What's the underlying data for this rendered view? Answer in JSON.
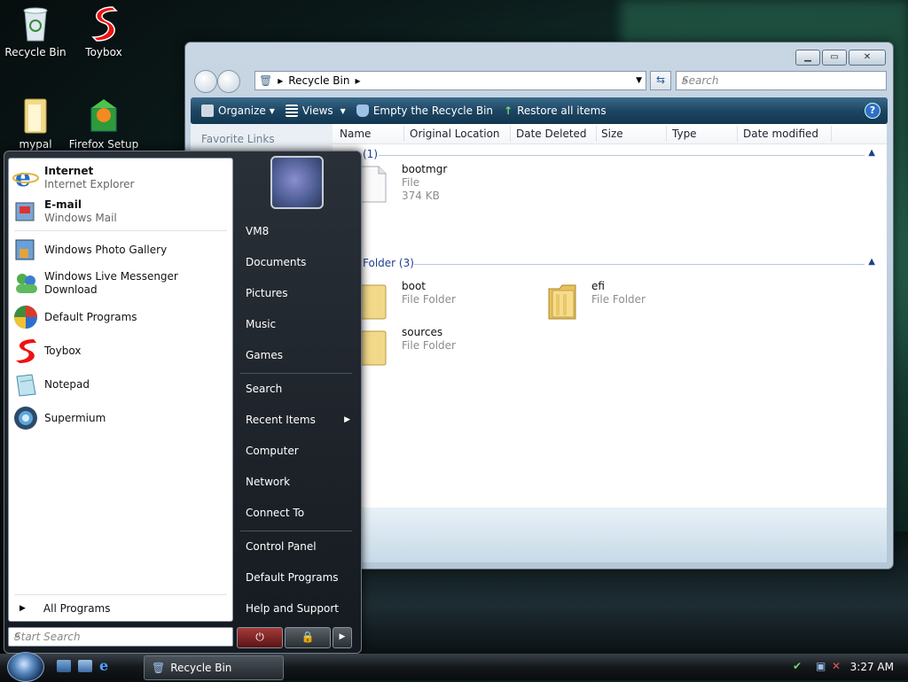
{
  "desktop": {
    "icons": [
      {
        "label": "Recycle Bin"
      },
      {
        "label": "Toybox"
      },
      {
        "label": "mypal"
      },
      {
        "label": "Firefox Setup"
      }
    ]
  },
  "explorer": {
    "address": {
      "segment": "Recycle Bin"
    },
    "search": {
      "placeholder": "Search"
    },
    "toolbar": {
      "organize": "Organize",
      "views": "Views",
      "empty": "Empty the Recycle Bin",
      "restore": "Restore all items"
    },
    "pane": {
      "title": "Favorite Links"
    },
    "columns": [
      "Name",
      "Original Location",
      "Date Deleted",
      "Size",
      "Type",
      "Date modified"
    ],
    "group1": {
      "label": "(1)"
    },
    "group2": {
      "label": "Folder (3)"
    },
    "files": [
      {
        "name": "bootmgr",
        "type": "File",
        "size": "374 KB"
      },
      {
        "name": "boot",
        "type": "File Folder"
      },
      {
        "name": "efi",
        "type": "File Folder"
      },
      {
        "name": "sources",
        "type": "File Folder"
      }
    ]
  },
  "start_menu": {
    "pinned": [
      {
        "title": "Internet",
        "sub": "Internet Explorer"
      },
      {
        "title": "E-mail",
        "sub": "Windows Mail"
      }
    ],
    "recent": [
      {
        "title": "Windows Photo Gallery"
      },
      {
        "title": "Windows Live Messenger Download"
      },
      {
        "title": "Default Programs"
      },
      {
        "title": "Toybox"
      },
      {
        "title": "Notepad"
      },
      {
        "title": "Supermium"
      }
    ],
    "all_programs": "All Programs",
    "search_placeholder": "Start Search",
    "right": [
      "VM8",
      "Documents",
      "Pictures",
      "Music",
      "Games",
      "Search",
      "Recent Items",
      "Computer",
      "Network",
      "Connect To",
      "Control Panel",
      "Default Programs",
      "Help and Support"
    ]
  },
  "taskbar": {
    "task": "Recycle Bin",
    "clock": "3:27 AM"
  }
}
